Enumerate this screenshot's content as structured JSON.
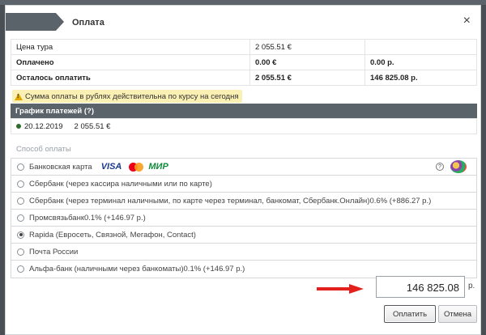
{
  "dialog": {
    "title": "Оплата",
    "close": "×"
  },
  "prices": [
    {
      "label": "Цена тура",
      "eur": "2 055.51 €",
      "rub": "",
      "bold": false
    },
    {
      "label": "Оплачено",
      "eur": "0.00 €",
      "rub": "0.00 р.",
      "bold": true
    },
    {
      "label": "Осталось оплатить",
      "eur": "2 055.51 €",
      "rub": "146 825.08 р.",
      "bold": true
    }
  ],
  "warning": "Сумма оплаты в рублях действительна по курсу на сегодня",
  "schedule": {
    "header": "График платежей (?)",
    "rows": [
      {
        "date": "20.12.2019",
        "amount": "2 055.51 €"
      }
    ]
  },
  "payment": {
    "section_label": "Способ оплаты",
    "card_brands": {
      "visa": "VISA",
      "mir": "МИР"
    },
    "methods": [
      {
        "label": "Банковская карта",
        "checked": false
      },
      {
        "label": "Сбербанк (через кассира наличными или по карте)",
        "checked": false
      },
      {
        "label": "Сбербанк (через терминал наличными, по карте через терминал, банкомат, Сбербанк.Онлайн)0.6% (+886.27 р.)",
        "checked": false
      },
      {
        "label": "Промсвязьбанк0.1% (+146.97 р.)",
        "checked": false
      },
      {
        "label": "Rapida (Евросеть, Связной, Мегафон, Contact)",
        "checked": true
      },
      {
        "label": "Почта России",
        "checked": false
      },
      {
        "label": "Альфа-банк (наличными через банкоматы)0.1% (+146.97 р.)",
        "checked": false
      }
    ]
  },
  "amount": {
    "value": "146 825.08",
    "currency": "р."
  },
  "buttons": {
    "pay": "Оплатить",
    "cancel": "Отмена"
  },
  "colors": {
    "header": "#5a626a",
    "warning_bg": "#fbf0b3",
    "arrow": "#e3201b"
  }
}
